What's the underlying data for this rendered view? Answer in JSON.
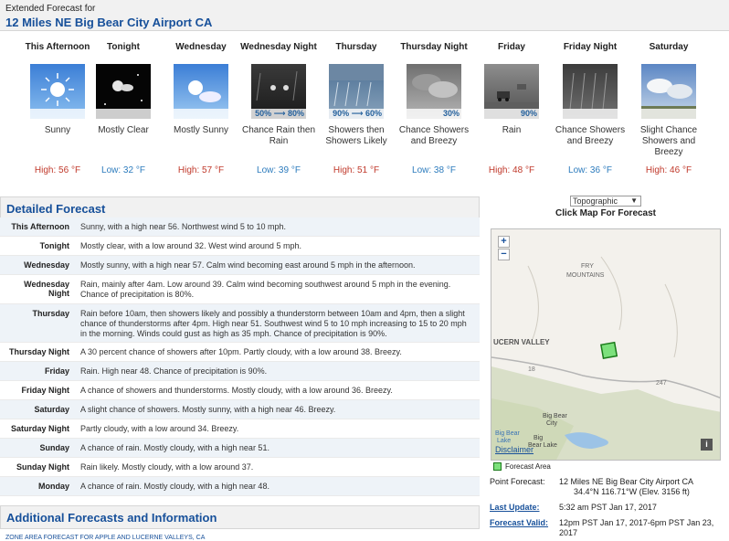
{
  "header": {
    "subtitle": "Extended Forecast for",
    "location": "12 Miles NE Big Bear City Airport CA"
  },
  "periods": [
    {
      "name": "This Afternoon",
      "short": "Sunny",
      "temp": "High: 56 °F",
      "type": "high",
      "pop": "",
      "icon": "sunny-icon"
    },
    {
      "name": "Tonight",
      "short": "Mostly Clear",
      "temp": "Low: 32 °F",
      "type": "low",
      "pop": "",
      "icon": "clear-night-icon"
    },
    {
      "name": "Wednesday",
      "short": "Mostly Sunny",
      "temp": "High: 57 °F",
      "type": "high",
      "pop": "",
      "icon": "mostly-sunny-icon"
    },
    {
      "name": "Wednesday Night",
      "short": "Chance Rain then Rain",
      "temp": "Low: 39 °F",
      "type": "low",
      "pop": "50% ⟶ 80%",
      "icon": "rain-night-icon"
    },
    {
      "name": "Thursday",
      "short": "Showers then Showers Likely",
      "temp": "High: 51 °F",
      "type": "high",
      "pop": "90% ⟶ 60%",
      "icon": "showers-icon"
    },
    {
      "name": "Thursday Night",
      "short": "Chance Showers and Breezy",
      "temp": "Low: 38 °F",
      "type": "low",
      "pop": "30%",
      "icon": "breezy-showers-icon"
    },
    {
      "name": "Friday",
      "short": "Rain",
      "temp": "High: 48 °F",
      "type": "high",
      "pop": "90%",
      "icon": "rain-icon"
    },
    {
      "name": "Friday Night",
      "short": "Chance Showers and Breezy",
      "temp": "Low: 36 °F",
      "type": "low",
      "pop": "",
      "icon": "night-showers-icon"
    },
    {
      "name": "Saturday",
      "short": "Slight Chance Showers and Breezy",
      "temp": "High: 46 °F",
      "type": "high",
      "pop": "",
      "icon": "slight-showers-icon"
    }
  ],
  "detailed": {
    "title": "Detailed Forecast",
    "rows": [
      {
        "label": "This Afternoon",
        "text": "Sunny, with a high near 56. Northwest wind 5 to 10 mph."
      },
      {
        "label": "Tonight",
        "text": "Mostly clear, with a low around 32. West wind around 5 mph."
      },
      {
        "label": "Wednesday",
        "text": "Mostly sunny, with a high near 57. Calm wind becoming east around 5 mph in the afternoon."
      },
      {
        "label": "Wednesday Night",
        "text": "Rain, mainly after 4am. Low around 39. Calm wind becoming southwest around 5 mph in the evening. Chance of precipitation is 80%."
      },
      {
        "label": "Thursday",
        "text": "Rain before 10am, then showers likely and possibly a thunderstorm between 10am and 4pm, then a slight chance of thunderstorms after 4pm. High near 51. Southwest wind 5 to 10 mph increasing to 15 to 20 mph in the morning. Winds could gust as high as 35 mph. Chance of precipitation is 90%."
      },
      {
        "label": "Thursday Night",
        "text": "A 30 percent chance of showers after 10pm. Partly cloudy, with a low around 38. Breezy."
      },
      {
        "label": "Friday",
        "text": "Rain. High near 48. Chance of precipitation is 90%."
      },
      {
        "label": "Friday Night",
        "text": "A chance of showers and thunderstorms. Mostly cloudy, with a low around 36. Breezy."
      },
      {
        "label": "Saturday",
        "text": "A slight chance of showers. Mostly sunny, with a high near 46. Breezy."
      },
      {
        "label": "Saturday Night",
        "text": "Partly cloudy, with a low around 34. Breezy."
      },
      {
        "label": "Sunday",
        "text": "A chance of rain. Mostly cloudy, with a high near 51."
      },
      {
        "label": "Sunday Night",
        "text": "Rain likely. Mostly cloudy, with a low around 37."
      },
      {
        "label": "Monday",
        "text": "A chance of rain. Mostly cloudy, with a high near 48."
      }
    ]
  },
  "map": {
    "select_value": "Topographic",
    "click_label": "Click Map For Forecast",
    "zoom_in": "+",
    "zoom_out": "−",
    "labels": {
      "fry": "FRY",
      "mountains": "MOUNTAINS",
      "lucern": "UCERN VALLEY",
      "route18": "18",
      "route247": "247",
      "bigbear_city_1": "Big Bear",
      "bigbear_city_2": "City",
      "bigbear_lake_1": "Big Bear",
      "bigbear_lake_2": "Lake",
      "bigbear_lake_3": "Big",
      "bigbear_lake_4": "Bear Lake"
    },
    "disclaimer": "Disclaimer",
    "info": "i",
    "legend": "Forecast Area"
  },
  "info": {
    "point_label": "Point Forecast:",
    "point_value_1": "12 Miles NE Big Bear City Airport CA",
    "point_value_2": "34.4°N 116.71°W (Elev. 3156 ft)",
    "update_label": "Last Update:",
    "update_value": "5:32 am PST Jan 17, 2017",
    "valid_label": "Forecast Valid:",
    "valid_value": "12pm PST Jan 17, 2017-6pm PST Jan 23, 2017"
  },
  "additional": {
    "title": "Additional Forecasts and Information",
    "link": "ZONE AREA FORECAST FOR APPLE AND LUCERNE VALLEYS, CA"
  },
  "colors": {
    "accent": "#17509a",
    "high": "#c0392b",
    "low": "#2c7bbd",
    "forecast_area": "#7ce07c"
  }
}
